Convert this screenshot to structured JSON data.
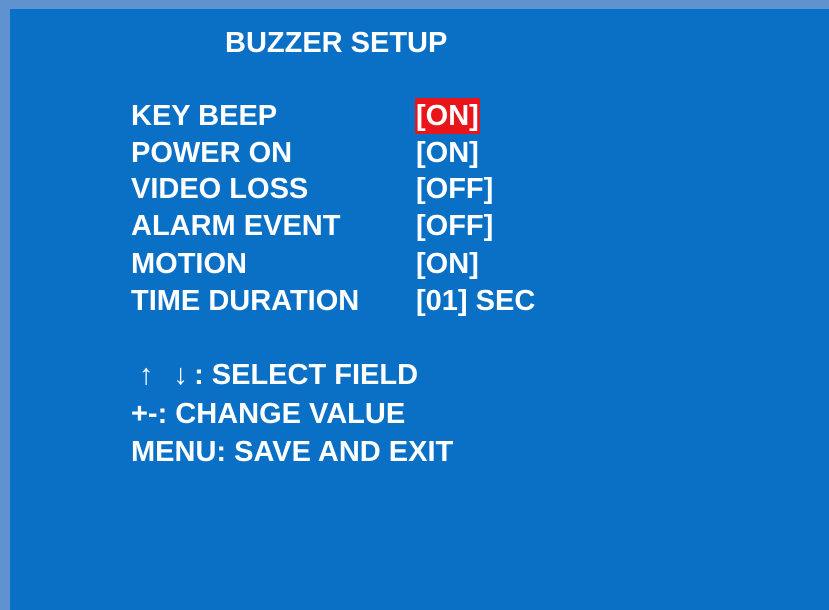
{
  "screen": {
    "title": "BUZZER SETUP"
  },
  "settings": [
    {
      "label": "KEY BEEP",
      "value": "[ON]",
      "selected": true
    },
    {
      "label": "POWER ON",
      "value": "[ON]",
      "selected": false
    },
    {
      "label": "VIDEO LOSS",
      "value": "[OFF]",
      "selected": false
    },
    {
      "label": "ALARM EVENT",
      "value": "[OFF]",
      "selected": false
    },
    {
      "label": "MOTION",
      "value": "[ON]",
      "selected": false
    },
    {
      "label": "TIME DURATION",
      "value": "[01] SEC",
      "selected": false
    }
  ],
  "help": {
    "select_arrows": "↑ ↓",
    "select_text": ": SELECT FIELD",
    "change": "+-: CHANGE VALUE",
    "menu": "MENU: SAVE AND EXIT"
  },
  "colors": {
    "background": "#0a70c6",
    "border": "#5f93cf",
    "text": "#ffffff",
    "highlight": "#e8151b"
  }
}
